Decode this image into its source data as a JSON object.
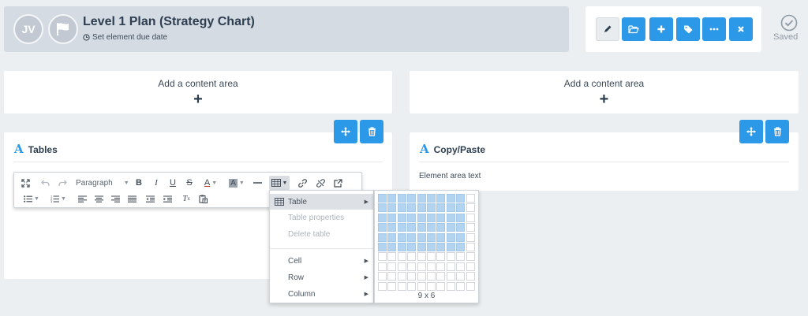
{
  "header": {
    "avatar_initials": "JV",
    "title": "Level 1 Plan (Strategy Chart)",
    "due_date_label": "Set element due date"
  },
  "actions": {
    "buttons": [
      "edit",
      "open-folder",
      "add",
      "tag",
      "more",
      "close"
    ],
    "status_label": "Saved"
  },
  "content_areas": [
    {
      "label": "Add a content area",
      "plus": "+"
    },
    {
      "label": "Add a content area",
      "plus": "+"
    }
  ],
  "panels": {
    "left": {
      "icon_letter": "A",
      "title": "Tables"
    },
    "right": {
      "icon_letter": "A",
      "title": "Copy/Paste",
      "body_text": "Element area text"
    }
  },
  "editor": {
    "block_format": "Paragraph"
  },
  "table_menu": {
    "items": [
      {
        "label": "Table",
        "has_submenu": true,
        "enabled": true
      },
      {
        "label": "Table properties",
        "has_submenu": false,
        "enabled": false
      },
      {
        "label": "Delete table",
        "has_submenu": false,
        "enabled": false
      },
      {
        "label": "Cell",
        "has_submenu": true,
        "enabled": true
      },
      {
        "label": "Row",
        "has_submenu": true,
        "enabled": true
      },
      {
        "label": "Column",
        "has_submenu": true,
        "enabled": true
      }
    ]
  },
  "grid_picker": {
    "columns": 10,
    "rows": 10,
    "selected_cols": 9,
    "selected_rows": 6,
    "size_label": "9 x 6"
  },
  "colors": {
    "accent": "#2b98e8",
    "header_bg": "#d5dbe3",
    "page_bg": "#eceff1",
    "grid_selected": "#b3d4f1"
  }
}
